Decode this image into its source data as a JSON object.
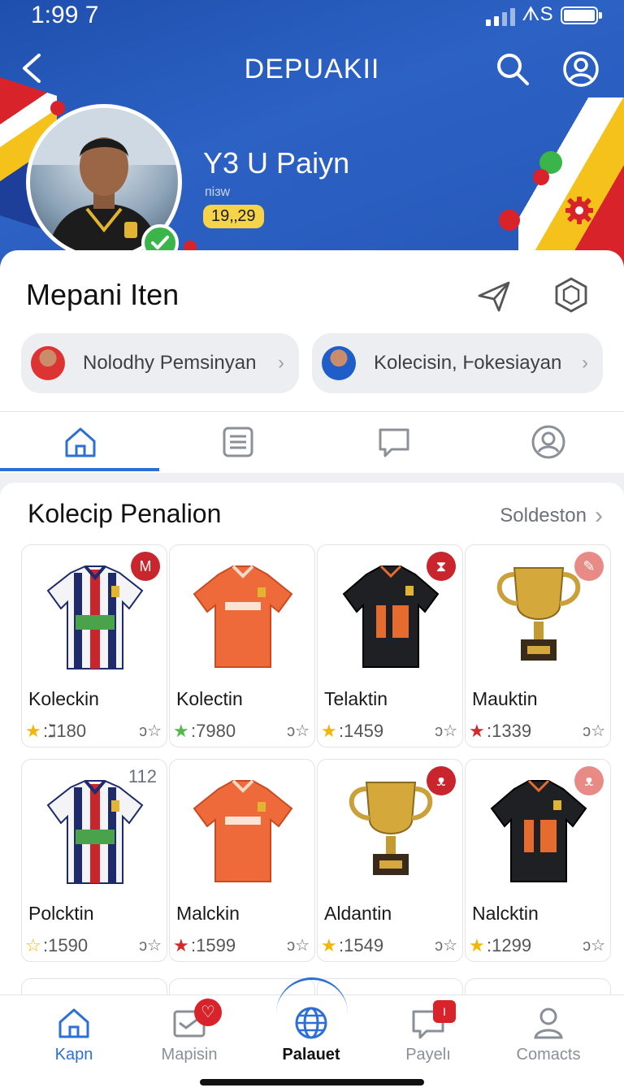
{
  "status_bar": {
    "time": "1:99 7",
    "carrier": "ᗑS"
  },
  "nav": {
    "title": "DEPUAKII"
  },
  "profile": {
    "name": "Y3 U Paiyn",
    "subtitle": "ᴨiɜw",
    "badge": "19,‚29"
  },
  "section": {
    "title": "Mepani Iten",
    "pills": [
      {
        "label": "Nolodhy Pemsinyan",
        "chevron": "›"
      },
      {
        "label": "Kolecisin, Ⱶokesiayan",
        "chevron": "›"
      }
    ]
  },
  "tabs": [
    {
      "icon": "home-icon"
    },
    {
      "icon": "list-icon"
    },
    {
      "icon": "chat-icon"
    },
    {
      "icon": "user-icon"
    }
  ],
  "collection": {
    "title": "Kolecip Penalion",
    "link_label": "Soldeston",
    "link_chevron": "›",
    "items": [
      {
        "name": "Koleckin",
        "stat": ":ℷ180",
        "star": "★",
        "star_color": "#f2b705",
        "fav": "ɔ☆",
        "tag": "M",
        "tag_color": "#c8262c",
        "kind": "stripe-jersey"
      },
      {
        "name": "Kolectin",
        "stat": ":7980",
        "star": "★",
        "star_color": "#55b949",
        "fav": "ɔ☆",
        "tag": "",
        "tag_color": "",
        "kind": "orange-jersey"
      },
      {
        "name": "Telaktin",
        "stat": ":1459",
        "star": "★",
        "star_color": "#f2b705",
        "fav": "ɔ☆",
        "tag": "⧗",
        "tag_color": "#c8262c",
        "kind": "black-jersey"
      },
      {
        "name": "Mauktin",
        "stat": ":1339",
        "star": "★",
        "star_color": "#d22a2a",
        "fav": "ɔ☆",
        "tag": "✎",
        "tag_color": "#e88b86",
        "kind": "trophy"
      },
      {
        "name": "Polcktin",
        "stat": ":1590",
        "star": "☆",
        "star_color": "#f2b705",
        "fav": "ɔ☆",
        "num_tag": "112",
        "kind": "stripe-jersey"
      },
      {
        "name": "Malckin",
        "stat": ":1599",
        "star": "★",
        "star_color": "#d22a2a",
        "fav": "ɔ☆",
        "tag": "",
        "tag_color": "",
        "kind": "orange-jersey"
      },
      {
        "name": "Aldantin",
        "stat": ":1549",
        "star": "★",
        "star_color": "#f2b705",
        "fav": "ɔ☆",
        "tag": "ᴥ",
        "tag_color": "#c8262c",
        "kind": "trophy"
      },
      {
        "name": "Nalcktin",
        "stat": ":1299",
        "star": "★",
        "star_color": "#f2b705",
        "fav": "ɔ☆",
        "tag": "ᴥ",
        "tag_color": "#e88b86",
        "kind": "black-jersey"
      }
    ]
  },
  "bottom_nav": [
    {
      "label": "Kapn",
      "icon": "home-icon",
      "state": "active"
    },
    {
      "label": "Mapisin",
      "icon": "inbox-icon",
      "badge": "♡"
    },
    {
      "label": "Palauet",
      "icon": "globe-icon",
      "state": "bold"
    },
    {
      "label": "Payelı",
      "icon": "message-icon",
      "badge": "I"
    },
    {
      "label": "Comacts",
      "icon": "contacts-icon"
    }
  ],
  "colors": {
    "primary": "#2c6fd6",
    "header_blue": "#2657b8",
    "badge_red": "#d8232a",
    "badge_yellow": "#f6d44a"
  }
}
